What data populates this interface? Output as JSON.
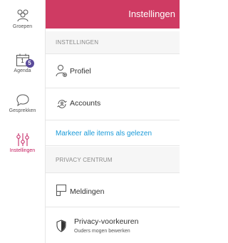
{
  "sidebar": {
    "items": [
      {
        "label": "Groepen",
        "icon": "group-icon"
      },
      {
        "label": "Agenda",
        "icon": "calendar-icon",
        "calendar_day": "1",
        "badge": "5"
      },
      {
        "label": "Gesprekken",
        "icon": "chat-bubble-icon"
      },
      {
        "label": "Instellingen",
        "icon": "sliders-icon",
        "active": true
      }
    ]
  },
  "header": {
    "title": "Instellingen"
  },
  "sections": [
    {
      "title": "INSTELLINGEN",
      "items": [
        {
          "label": "Profiel",
          "icon": "profile-settings-icon"
        },
        {
          "label": "Accounts",
          "icon": "accounts-icon"
        },
        {
          "label": "Markeer alle items als gelezen",
          "type": "link"
        }
      ]
    },
    {
      "title": "PRIVACY CENTRUM",
      "items": [
        {
          "label": "Meldingen",
          "icon": "notifications-icon"
        },
        {
          "label": "Privacy-voorkeuren",
          "sublabel": "Ouders mogen bewerken",
          "icon": "shield-icon"
        }
      ]
    }
  ],
  "colors": {
    "accent": "#cf3b63",
    "active_nav": "#c2185b",
    "link": "#1a9ad8",
    "section_bg": "#f6f6f6",
    "badge": "#5a4a9a"
  }
}
